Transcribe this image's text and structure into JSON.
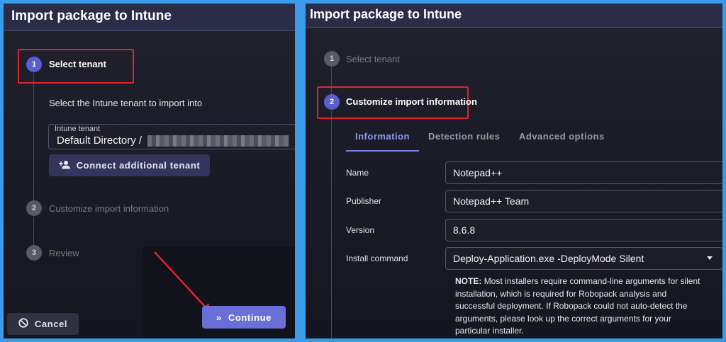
{
  "left_panel": {
    "title": "Import package to Intune",
    "steps": [
      {
        "number": "1",
        "label": "Select tenant"
      },
      {
        "number": "2",
        "label": "Customize import information"
      },
      {
        "number": "3",
        "label": "Review"
      }
    ],
    "instruction": "Select the Intune tenant to import into",
    "tenant_field": {
      "label": "Intune tenant",
      "value": "Default Directory /"
    },
    "connect_button": "Connect additional tenant",
    "cancel_button": "Cancel",
    "continue_button": "Continue"
  },
  "right_panel": {
    "title": "Import package to Intune",
    "steps": [
      {
        "number": "1",
        "label": "Select tenant"
      },
      {
        "number": "2",
        "label": "Customize import information"
      }
    ],
    "tabs": [
      "Information",
      "Detection rules",
      "Advanced options"
    ],
    "fields": [
      {
        "label": "Name",
        "value": "Notepad++"
      },
      {
        "label": "Publisher",
        "value": "Notepad++ Team"
      },
      {
        "label": "Version",
        "value": "8.6.8"
      },
      {
        "label": "Install command",
        "value": "Deploy-Application.exe -DeployMode Silent"
      }
    ],
    "note_prefix": "NOTE:",
    "note_text": "Most installers require command-line arguments for silent installation, which is required for Robopack analysis and successful deployment. If Robopack could not auto-detect the arguments, please look up the correct arguments for your particular installer."
  },
  "colors": {
    "accent": "#5a5fd0",
    "highlight_box": "#e0242a",
    "annotation_arrow": "#e0242a",
    "frame": "#3a9be8"
  }
}
